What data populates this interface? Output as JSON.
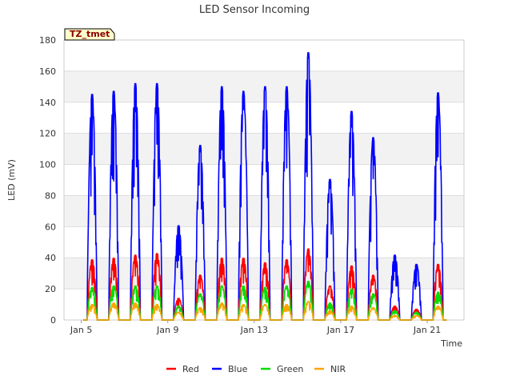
{
  "chart_data": {
    "type": "line",
    "title": "LED Sensor Incoming",
    "xlabel": "Time",
    "ylabel": "LED (mV)",
    "site_label": "TZ_tmet",
    "ylim": [
      0,
      180
    ],
    "yticks": [
      0,
      20,
      40,
      60,
      80,
      100,
      120,
      140,
      160,
      180
    ],
    "xlim": [
      4.2,
      22.7
    ],
    "xticks": [
      {
        "day": 5,
        "label": "Jan 5"
      },
      {
        "day": 9,
        "label": "Jan 9"
      },
      {
        "day": 13,
        "label": "Jan 13"
      },
      {
        "day": 17,
        "label": "Jan 17"
      },
      {
        "day": 21,
        "label": "Jan 21"
      }
    ],
    "grid": true,
    "legend": "bottom",
    "days": [
      "Jan 5",
      "Jan 6",
      "Jan 7",
      "Jan 8",
      "Jan 9",
      "Jan 10",
      "Jan 11",
      "Jan 12",
      "Jan 13",
      "Jan 14",
      "Jan 15",
      "Jan 16",
      "Jan 17",
      "Jan 18",
      "Jan 19",
      "Jan 20",
      "Jan 21",
      "Jan 22"
    ],
    "series": [
      {
        "name": "Red",
        "color": "#ff0000",
        "daily_peak": [
          39,
          40,
          42,
          43,
          14,
          29,
          40,
          40,
          37,
          39,
          46,
          22,
          35,
          29,
          9,
          7,
          36,
          0
        ]
      },
      {
        "name": "Blue",
        "color": "#0000ff",
        "daily_peak": [
          146,
          148,
          153,
          153,
          61,
          113,
          151,
          148,
          151,
          151,
          173,
          91,
          135,
          118,
          42,
          36,
          147,
          0
        ]
      },
      {
        "name": "Green",
        "color": "#00dd00",
        "daily_peak": [
          21,
          22,
          22,
          22,
          9,
          17,
          22,
          22,
          21,
          22,
          25,
          11,
          20,
          17,
          6,
          5,
          18,
          0
        ]
      },
      {
        "name": "NIR",
        "color": "#ffa500",
        "daily_peak": [
          10,
          11,
          11,
          10,
          5,
          8,
          11,
          10,
          10,
          10,
          12,
          6,
          9,
          8,
          3,
          3,
          9,
          0
        ]
      }
    ]
  }
}
